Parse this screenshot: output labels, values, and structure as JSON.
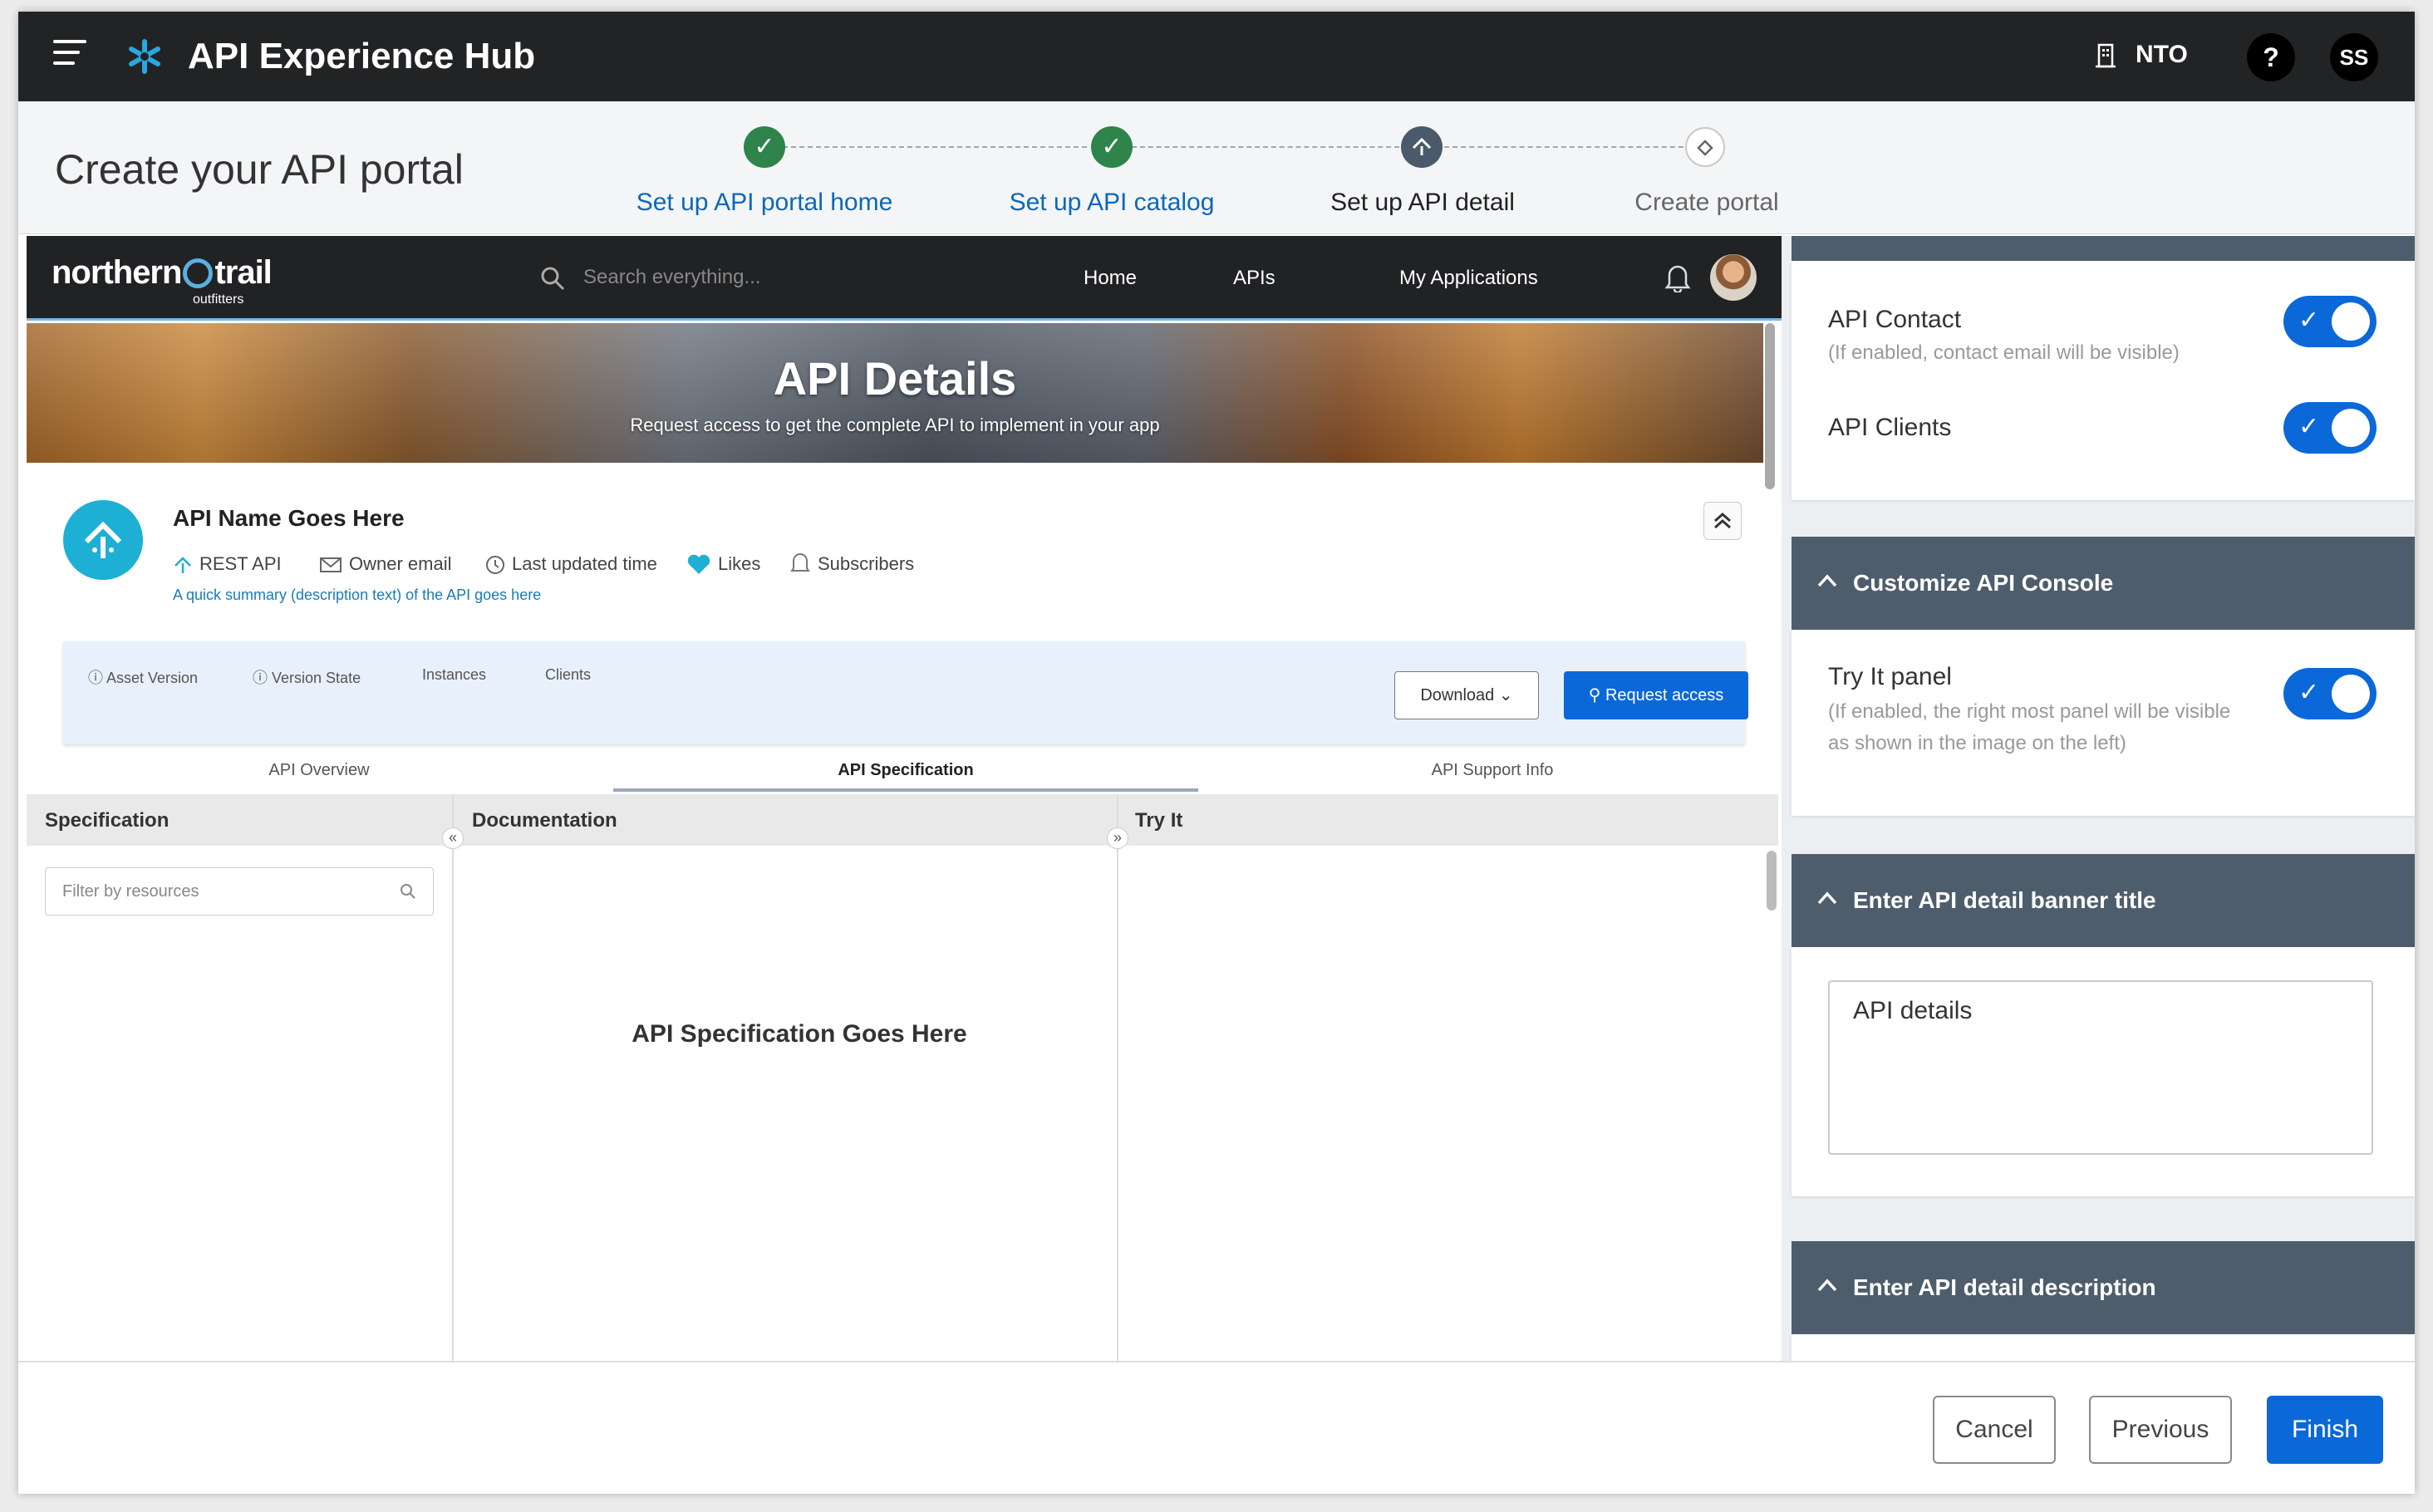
{
  "app": {
    "title": "API Experience Hub",
    "org": "NTO",
    "help": "?",
    "user_initials": "SS"
  },
  "wizard": {
    "page_title": "Create your API portal",
    "steps": [
      {
        "label": "Set up API portal home",
        "state": "done"
      },
      {
        "label": "Set up API catalog",
        "state": "done"
      },
      {
        "label": "Set up API detail",
        "state": "current"
      },
      {
        "label": "Create portal",
        "state": "pending"
      }
    ]
  },
  "preview": {
    "brand": "northern",
    "brand_suffix": "trail",
    "brand_sub": "outfitters",
    "search_placeholder": "Search everything...",
    "nav": [
      "Home",
      "APIs",
      "My Applications"
    ],
    "banner_title": "API Details",
    "banner_subtitle": "Request access to get the complete API to implement in your app",
    "api_name": "API Name Goes Here",
    "meta": [
      "REST API",
      "Owner email",
      "Last updated time",
      "Likes",
      "Subscribers"
    ],
    "summary": "A quick summary (description text) of the API goes here",
    "info_items": [
      "Asset Version",
      "Version State",
      "Instances",
      "Clients"
    ],
    "download_label": "Download",
    "request_label": "Request access",
    "tabs": [
      "API Overview",
      "API  Specification",
      "API Support Info"
    ],
    "columns": [
      "Specification",
      "Documentation",
      "Try It"
    ],
    "filter_placeholder": "Filter by resources",
    "spec_placeholder": "API Specification Goes Here"
  },
  "settings": {
    "api_contact_label": "API Contact",
    "api_contact_hint": "(If enabled, contact email will be visible)",
    "api_clients_label": "API Clients",
    "console_section": "Customize API Console",
    "try_it_label": "Try It panel",
    "try_it_hint": "(If enabled, the right most panel will be visible as shown in the image on the left)",
    "banner_section": "Enter API detail banner title",
    "banner_value": "API details",
    "description_section": "Enter API detail description",
    "toggles": {
      "api_contact": true,
      "api_clients": true,
      "try_it": true
    }
  },
  "footer": {
    "cancel": "Cancel",
    "previous": "Previous",
    "finish": "Finish"
  },
  "colors": {
    "primary": "#0b68d8",
    "topbar": "#222324",
    "step_done": "#2e844a",
    "section_header": "#4e5d6c",
    "api_icon": "#1db0d4"
  }
}
